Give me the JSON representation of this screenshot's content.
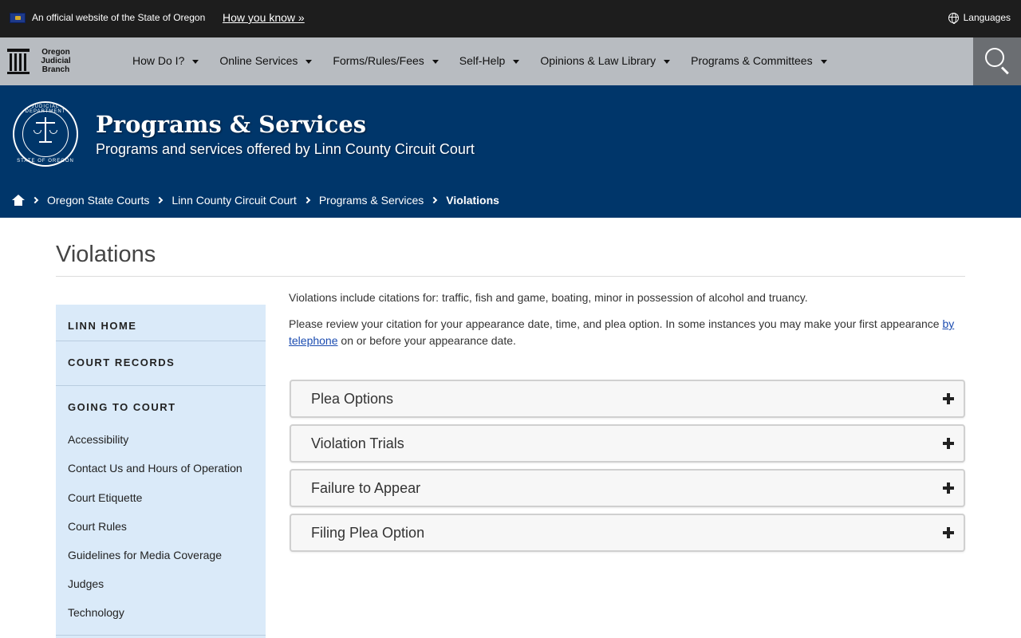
{
  "official_bar": {
    "text": "An official website of the State of Oregon",
    "how_you_know": "How you know »",
    "languages": "Languages"
  },
  "nav": {
    "logo_lines": [
      "Oregon",
      "Judicial",
      "Branch"
    ],
    "items": [
      {
        "label": "How Do I?"
      },
      {
        "label": "Online Services"
      },
      {
        "label": "Forms/Rules/Fees"
      },
      {
        "label": "Self-Help"
      },
      {
        "label": "Opinions & Law Library"
      },
      {
        "label": "Programs & Committees"
      }
    ]
  },
  "banner": {
    "seal_top": "JUDICIAL DEPARTMENT",
    "seal_bottom": "STATE OF OREGON",
    "title": "Programs & Services",
    "subtitle": "Programs and services offered by Linn County Circuit Court"
  },
  "breadcrumb": {
    "items": [
      "Oregon State Courts",
      "Linn County Circuit Court",
      "Programs & Services"
    ],
    "current": "Violations"
  },
  "page": {
    "title": "Violations",
    "intro1": "Violations include citations for: traffic, fish and game, boating, minor in possession of alcohol and truancy.",
    "intro2_before": "Please review your citation for your appearance date, time, and plea option. In some instances you may make your first appearance ",
    "intro2_link": "by telephone",
    "intro2_after": " on or before your appearance date."
  },
  "sidebar": {
    "heads": [
      "LINN HOME",
      "COURT RECORDS",
      "GOING TO COURT"
    ],
    "links": [
      "Accessibility",
      "Contact Us and Hours of Operation",
      "Court Etiquette",
      "Court Rules",
      "Guidelines for Media Coverage",
      "Judges",
      "Technology"
    ]
  },
  "accordion": {
    "items": [
      "Plea Options",
      "Violation Trials",
      "Failure to Appear",
      "Filing Plea Option"
    ]
  }
}
